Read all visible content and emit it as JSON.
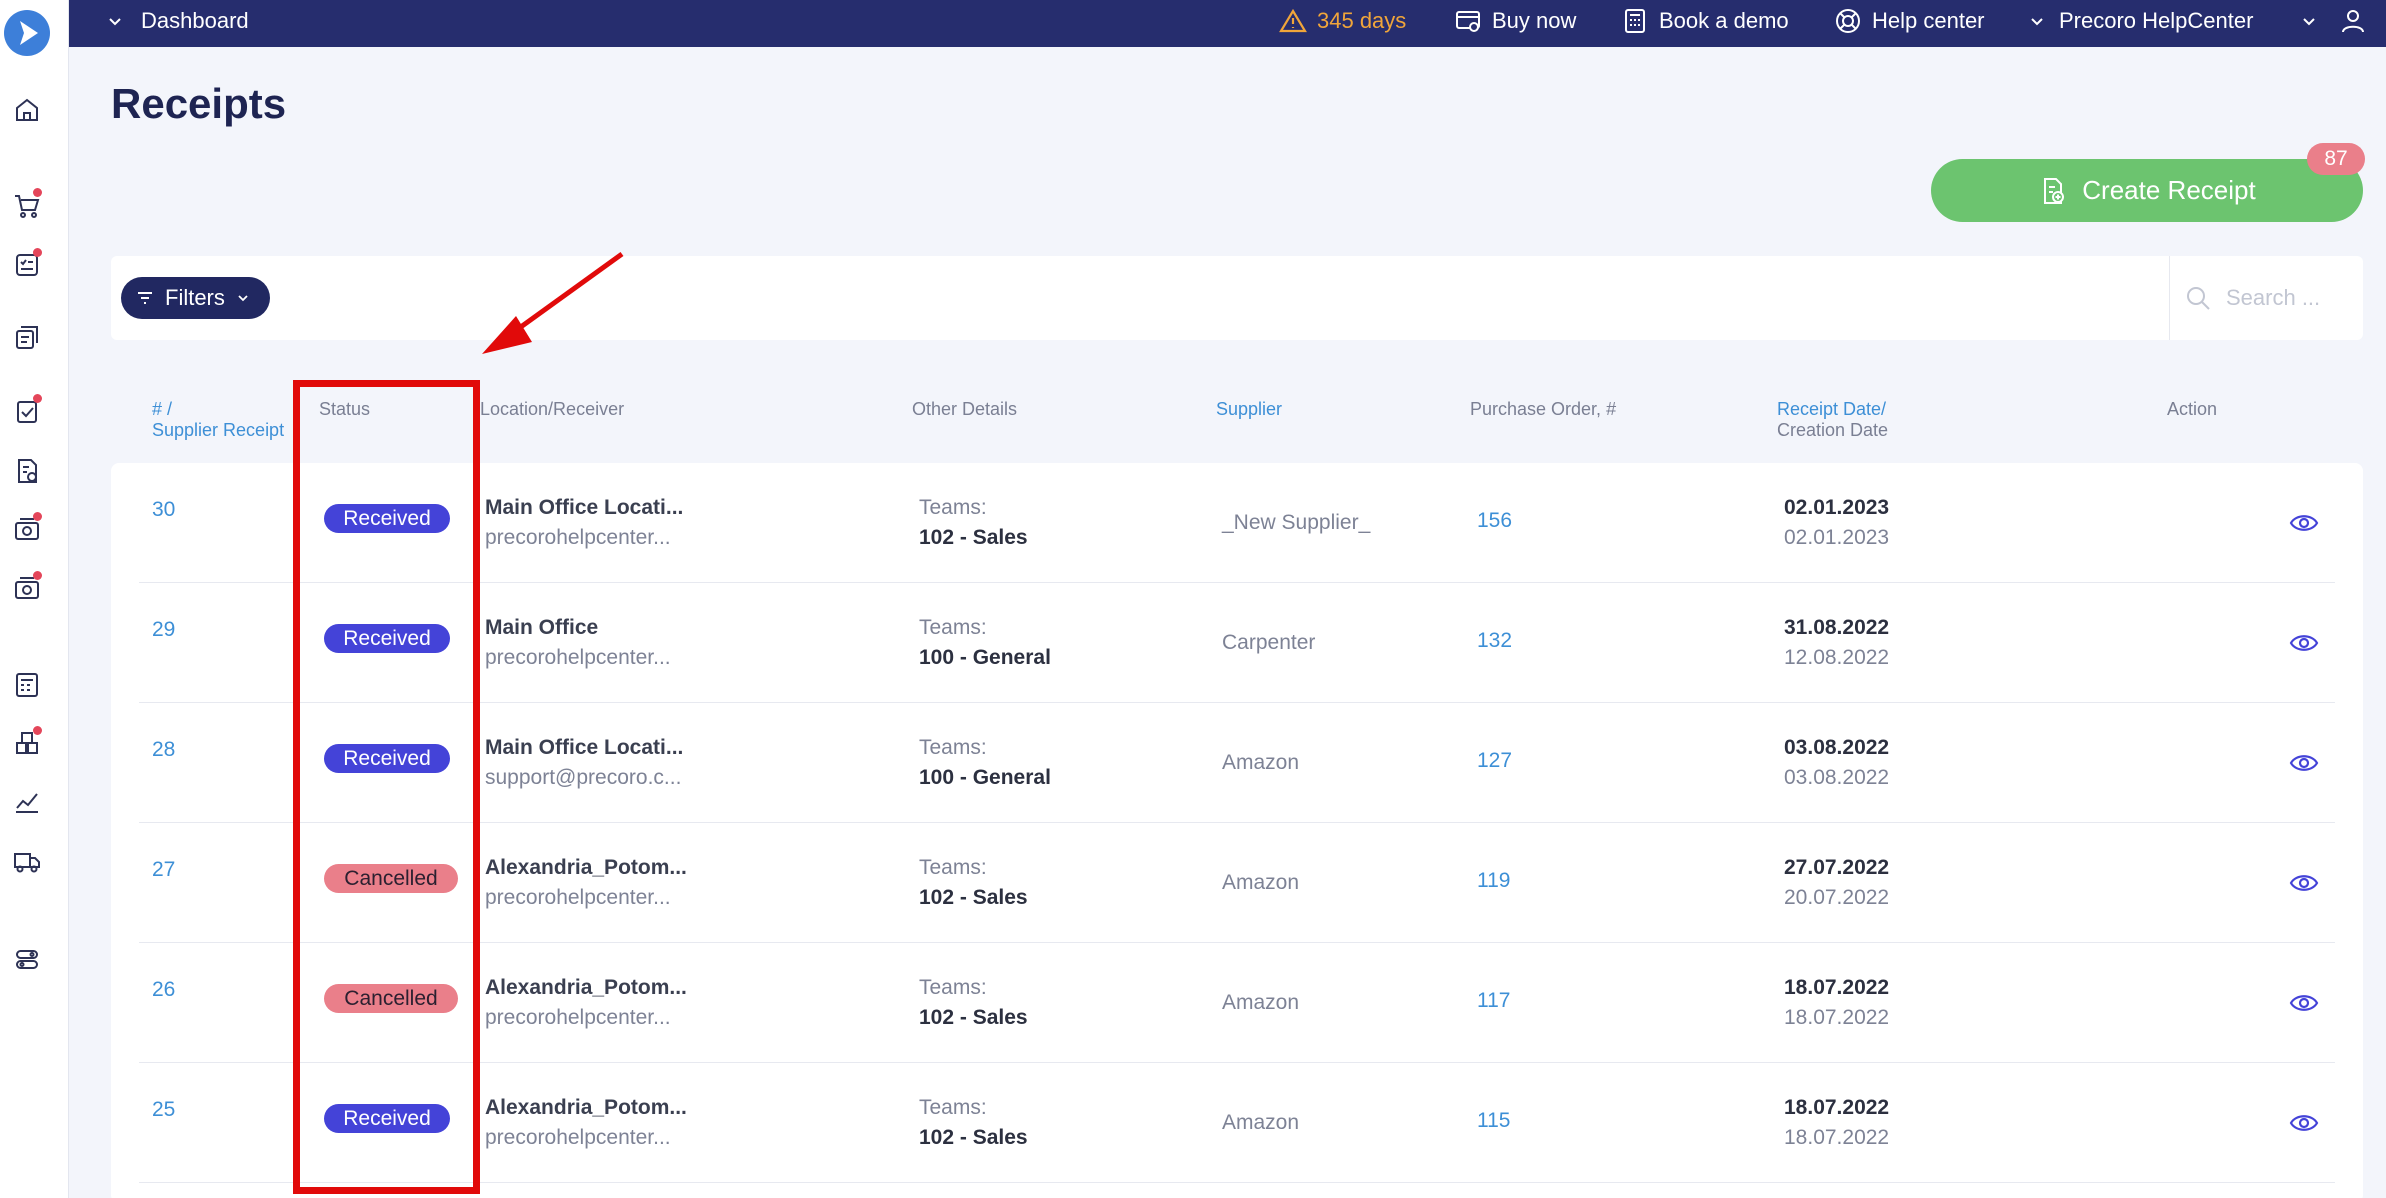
{
  "topbar": {
    "dashboard_label": "Dashboard",
    "trial_label": "345 days",
    "buy_label": "Buy now",
    "demo_label": "Book a demo",
    "help_label": "Help center",
    "company_label": "Precoro HelpCenter"
  },
  "page": {
    "title": "Receipts",
    "create_label": "Create Receipt",
    "badge_count": "87",
    "filters_label": "Filters",
    "search_placeholder": "Search ..."
  },
  "table": {
    "headers": {
      "num_line1": "# /",
      "num_line2": "Supplier Receipt",
      "status": "Status",
      "location": "Location/Receiver",
      "details": "Other Details",
      "supplier": "Supplier",
      "po": "Purchase Order, #",
      "date_line1": "Receipt Date/",
      "date_line2": "Creation Date",
      "action": "Action"
    },
    "rows": [
      {
        "num": "30",
        "status": "Received",
        "location": "Main Office Locati...",
        "receiver": "precorohelpcenter...",
        "teams_label": "Teams:",
        "team": "102 - Sales",
        "supplier": "_New Supplier_",
        "po": "156",
        "receipt_date": "02.01.2023",
        "creation_date": "02.01.2023"
      },
      {
        "num": "29",
        "status": "Received",
        "location": "Main Office",
        "receiver": "precorohelpcenter...",
        "teams_label": "Teams:",
        "team": "100 - General",
        "supplier": "Carpenter",
        "po": "132",
        "receipt_date": "31.08.2022",
        "creation_date": "12.08.2022"
      },
      {
        "num": "28",
        "status": "Received",
        "location": "Main Office Locati...",
        "receiver": "support@precoro.c...",
        "teams_label": "Teams:",
        "team": "100 - General",
        "supplier": "Amazon",
        "po": "127",
        "receipt_date": "03.08.2022",
        "creation_date": "03.08.2022"
      },
      {
        "num": "27",
        "status": "Cancelled",
        "location": "Alexandria_Potom...",
        "receiver": "precorohelpcenter...",
        "teams_label": "Teams:",
        "team": "102 - Sales",
        "supplier": "Amazon",
        "po": "119",
        "receipt_date": "27.07.2022",
        "creation_date": "20.07.2022"
      },
      {
        "num": "26",
        "status": "Cancelled",
        "location": "Alexandria_Potom...",
        "receiver": "precorohelpcenter...",
        "teams_label": "Teams:",
        "team": "102 - Sales",
        "supplier": "Amazon",
        "po": "117",
        "receipt_date": "18.07.2022",
        "creation_date": "18.07.2022"
      },
      {
        "num": "25",
        "status": "Received",
        "location": "Alexandria_Potom...",
        "receiver": "precorohelpcenter...",
        "teams_label": "Teams:",
        "team": "102 - Sales",
        "supplier": "Amazon",
        "po": "115",
        "receipt_date": "18.07.2022",
        "creation_date": "18.07.2022"
      }
    ]
  },
  "sidebar_icons": [
    "home-icon",
    "cart-icon",
    "checklist-icon",
    "orders-icon",
    "approval-icon",
    "invoice-icon",
    "receipt-icon",
    "payment-icon",
    "budget-icon",
    "inventory-icon",
    "analytics-icon",
    "delivery-icon",
    "settings-icon"
  ],
  "colors": {
    "topbar": "#262d6e",
    "create_button": "#6cc46f",
    "received": "#4443d8",
    "cancelled": "#ea7f8a",
    "link": "#3d8fd6",
    "annotation": "#e10a0a"
  }
}
